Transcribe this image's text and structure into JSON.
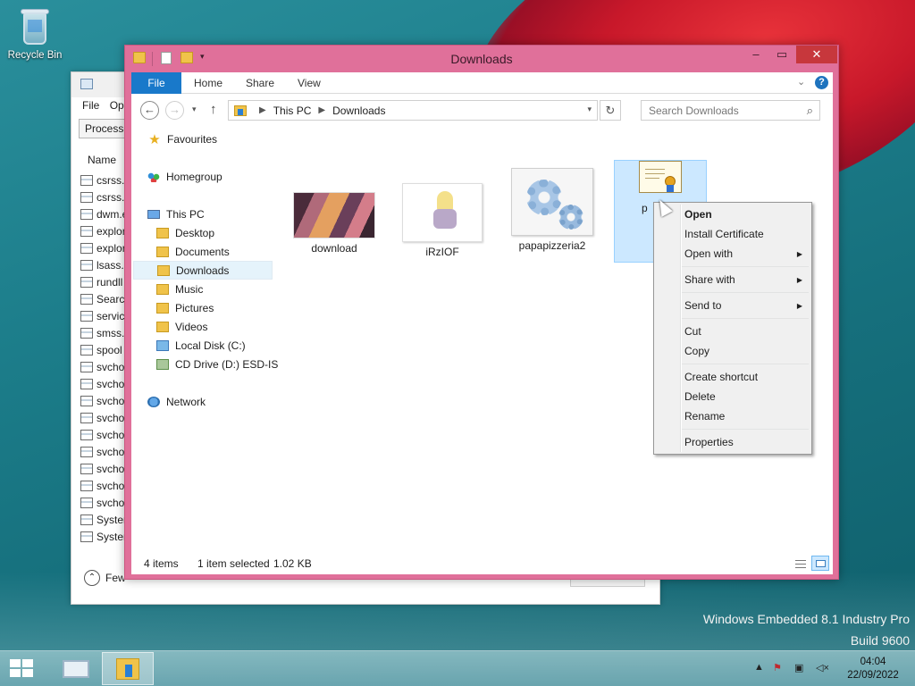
{
  "desktop": {
    "recycle_bin_label": "Recycle Bin",
    "watermark_line1": "Windows Embedded 8.1 Industry Pro",
    "watermark_line2": "Build 9600"
  },
  "task_manager": {
    "menu": [
      "File",
      "Op"
    ],
    "tab_label": "Processe",
    "column_name": "Name",
    "processes": [
      "csrss.e",
      "csrss.e",
      "dwm.e",
      "explor",
      "explor",
      "lsass.e",
      "rundll",
      "Search",
      "servic",
      "smss.e",
      "spool",
      "svcho",
      "svcho",
      "svcho",
      "svcho",
      "svcho",
      "svcho",
      "svcho",
      "svcho",
      "svcho",
      "System",
      "System"
    ],
    "footer_label": "Few"
  },
  "explorer": {
    "title": "Downloads",
    "ribbon_tabs": {
      "file": "File",
      "home": "Home",
      "share": "Share",
      "view": "View"
    },
    "help_label": "?",
    "breadcrumb": [
      "This PC",
      "Downloads"
    ],
    "search_placeholder": "Search Downloads",
    "nav": {
      "favourites": "Favourites",
      "homegroup": "Homegroup",
      "this_pc": "This PC",
      "desktop": "Desktop",
      "documents": "Documents",
      "downloads": "Downloads",
      "music": "Music",
      "pictures": "Pictures",
      "videos": "Videos",
      "local_disk": "Local Disk (C:)",
      "cd_drive": "CD Drive (D:) ESD-IS",
      "network": "Network"
    },
    "files": {
      "download": "download",
      "irz": "iRzIOF",
      "papa": "papapizzeria2",
      "cert": "p"
    },
    "status": {
      "item_count": "4 items",
      "selection": "1 item selected",
      "size": "1.02 KB"
    }
  },
  "context_menu": {
    "open": "Open",
    "install_certificate": "Install Certificate",
    "open_with": "Open with",
    "share_with": "Share with",
    "send_to": "Send to",
    "cut": "Cut",
    "copy": "Copy",
    "create_shortcut": "Create shortcut",
    "delete": "Delete",
    "rename": "Rename",
    "properties": "Properties"
  },
  "taskbar": {
    "time": "04:04",
    "date": "22/09/2022"
  },
  "colors": {
    "window_frame": "#e0709a",
    "close_button": "#c7373c",
    "file_tab": "#1979ca",
    "selection": "#cce8ff"
  }
}
